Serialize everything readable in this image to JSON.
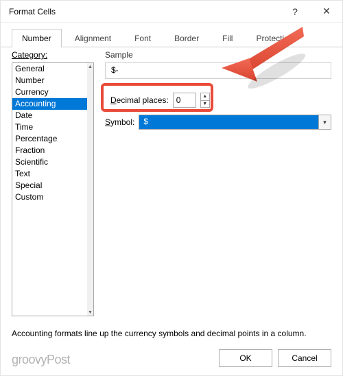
{
  "dialog": {
    "title": "Format Cells",
    "help_glyph": "?",
    "close_glyph": "✕"
  },
  "tabs": {
    "number": "Number",
    "alignment": "Alignment",
    "font": "Font",
    "border": "Border",
    "fill": "Fill",
    "protection": "Protection"
  },
  "category": {
    "label": "Category:",
    "items": {
      "general": "General",
      "number": "Number",
      "currency": "Currency",
      "accounting": "Accounting",
      "date": "Date",
      "time": "Time",
      "percentage": "Percentage",
      "fraction": "Fraction",
      "scientific": "Scientific",
      "text": "Text",
      "special": "Special",
      "custom": "Custom"
    }
  },
  "sample": {
    "label": "Sample",
    "value": "$-"
  },
  "decimal": {
    "label_prefix": "D",
    "label_rest": "ecimal places:",
    "value": "0"
  },
  "symbol": {
    "label_prefix": "S",
    "label_rest": "ymbol:",
    "value": "$"
  },
  "description": "Accounting formats line up the currency symbols and decimal points in a column.",
  "buttons": {
    "ok": "OK",
    "cancel": "Cancel"
  },
  "watermark": "groovyPost"
}
